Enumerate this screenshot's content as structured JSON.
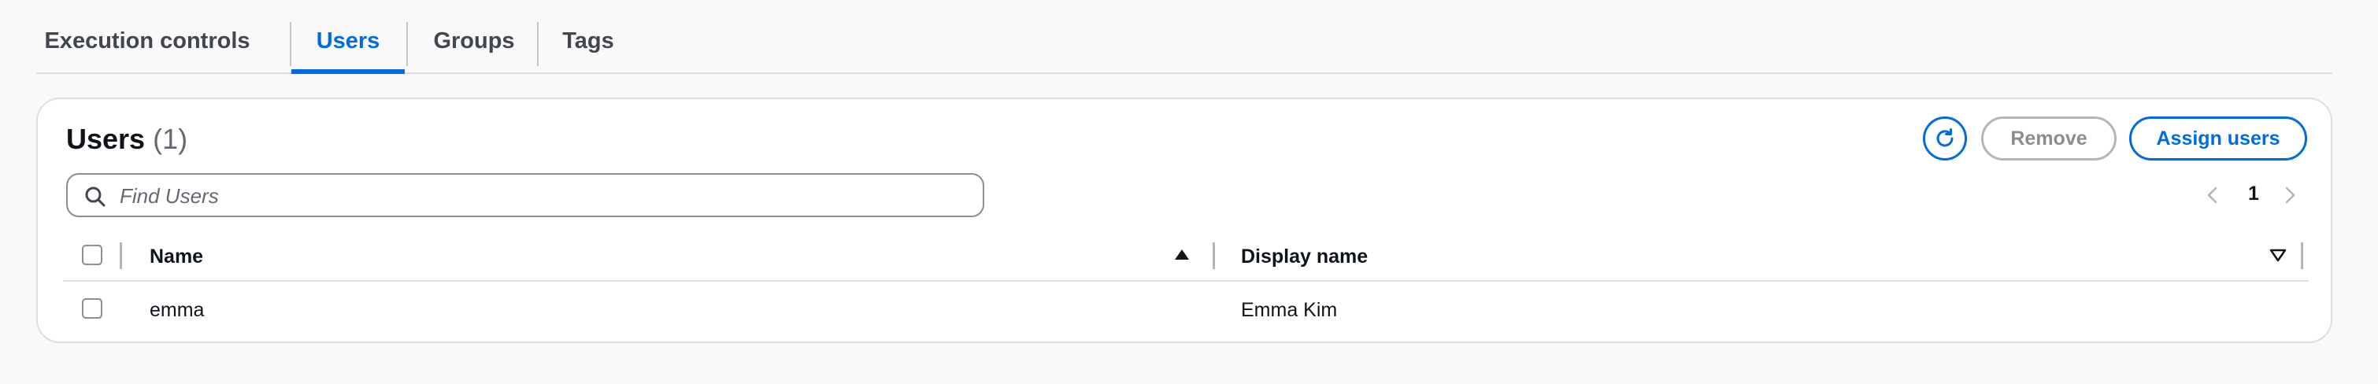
{
  "tabs": [
    {
      "label": "Execution controls",
      "active": false
    },
    {
      "label": "Users",
      "active": true
    },
    {
      "label": "Groups",
      "active": false
    },
    {
      "label": "Tags",
      "active": false
    }
  ],
  "panel": {
    "title": "Users",
    "count": "(1)",
    "search": {
      "placeholder": "Find Users",
      "value": ""
    },
    "actions": {
      "refresh_icon": "refresh-icon",
      "remove_label": "Remove",
      "assign_label": "Assign users"
    },
    "pagination": {
      "current_page": "1"
    },
    "table": {
      "columns": [
        {
          "label": "Name",
          "sort": "ascending"
        },
        {
          "label": "Display name",
          "sort": "none"
        }
      ],
      "rows": [
        {
          "name": "emma",
          "display_name": "Emma Kim",
          "selected": false
        }
      ]
    }
  },
  "colors": {
    "accent": "#006ce0",
    "text": "#0f141a",
    "muted": "#656871",
    "border": "#dedee3",
    "disabled": "#8c8c94",
    "background": "#f9f9f9"
  }
}
